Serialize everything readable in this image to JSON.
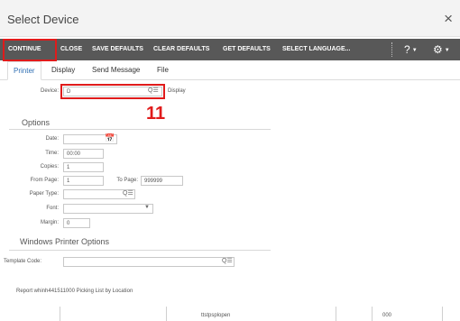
{
  "dialog": {
    "title": "Select Device",
    "close_glyph": "×"
  },
  "toolbar": {
    "continue_label": "CONTINUE",
    "close_label": "CLOSE",
    "save_defaults_label": "SAVE DEFAULTS",
    "clear_defaults_label": "CLEAR DEFAULTS",
    "get_defaults_label": "GET DEFAULTS",
    "select_language_label": "SELECT LANGUAGE...",
    "help_glyph": "?",
    "settings_glyph": "⚙"
  },
  "tabs": [
    {
      "label": "Printer",
      "active": true
    },
    {
      "label": "Display",
      "active": false
    },
    {
      "label": "Send Message",
      "active": false
    },
    {
      "label": "File",
      "active": false
    }
  ],
  "device": {
    "label": "Device:",
    "value": "D",
    "description": "Display"
  },
  "annotation": {
    "number": "11"
  },
  "options": {
    "title": "Options",
    "date_label": "Date:",
    "date_value": "",
    "time_label": "Time:",
    "time_value": "00:00",
    "copies_label": "Copies:",
    "copies_value": "1",
    "from_page_label": "From Page:",
    "from_page_value": "1",
    "to_page_label": "To Page:",
    "to_page_value": "999999",
    "paper_type_label": "Paper Type:",
    "paper_type_value": "",
    "font_label": "Font:",
    "font_value": "",
    "margin_label": "Margin:",
    "margin_value": "0"
  },
  "windows_options": {
    "title": "Windows Printer Options",
    "template_code_label": "Template Code:",
    "template_code_value": ""
  },
  "report": {
    "text": "Report whinh441511000 Picking List by Location"
  },
  "footer": {
    "session_name": "ttstpsplopen",
    "value": "000"
  },
  "colors": {
    "toolbar_bg": "#585858",
    "active_tab": "#2f6fb3",
    "highlight": "#e01b1b"
  }
}
